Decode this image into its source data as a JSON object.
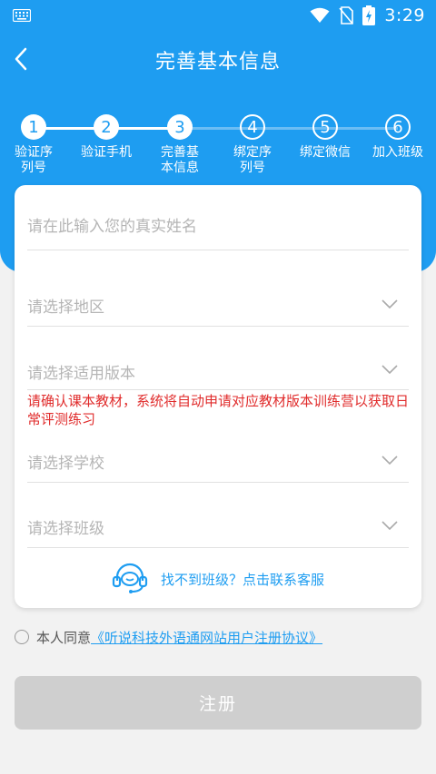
{
  "status_bar": {
    "time": "3:29"
  },
  "header": {
    "title": "完善基本信息"
  },
  "steps": [
    {
      "num": "1",
      "label": "验证序\n列号",
      "active": true
    },
    {
      "num": "2",
      "label": "验证手机",
      "active": true
    },
    {
      "num": "3",
      "label": "完善基\n本信息",
      "active": true
    },
    {
      "num": "4",
      "label": "绑定序\n列号",
      "active": false
    },
    {
      "num": "5",
      "label": "绑定微信",
      "active": false
    },
    {
      "num": "6",
      "label": "加入班级",
      "active": false
    }
  ],
  "form": {
    "name_placeholder": "请在此输入您的真实姓名",
    "region_placeholder": "请选择地区",
    "version_placeholder": "请选择适用版本",
    "warning": "请确认课本教材，系统将自动申请对应教材版本训练营以获取日常评测练习",
    "school_placeholder": "请选择学校",
    "class_placeholder": "请选择班级",
    "support_text": "找不到班级？点击联系客服"
  },
  "agreement": {
    "prefix": "本人同意",
    "link": "《听说科技外语通网站用户注册协议》"
  },
  "register_button": "注册",
  "colors": {
    "primary": "#1e9df1",
    "warning": "#e02b2b",
    "disabled": "#cfcfcf"
  },
  "icons": [
    "keyboard-icon",
    "wifi-icon",
    "no-sim-icon",
    "battery-charging-icon",
    "back-arrow-icon",
    "chevron-down-icon",
    "headset-support-icon"
  ]
}
